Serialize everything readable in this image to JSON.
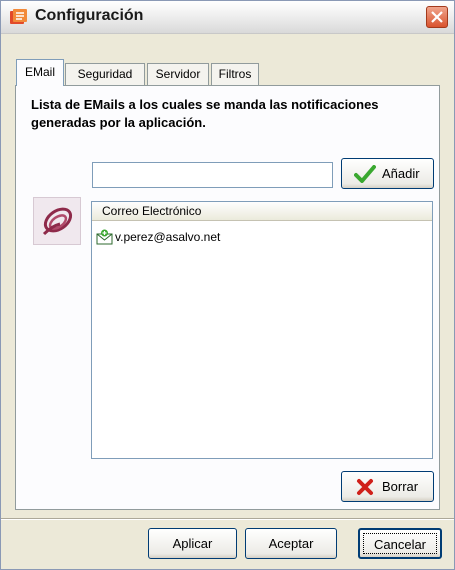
{
  "window": {
    "title": "Configuración"
  },
  "tabs": [
    {
      "label": "EMail",
      "active": true
    },
    {
      "label": "Seguridad",
      "active": false
    },
    {
      "label": "Servidor",
      "active": false
    },
    {
      "label": "Filtros",
      "active": false
    }
  ],
  "email_tab": {
    "description": "Lista de EMails a los cuales se manda las notificaciones generadas por la aplicación.",
    "email_input_value": "",
    "add_label": "Añadir",
    "list_header": "Correo Electrónico",
    "emails": [
      "v.perez@asalvo.net"
    ],
    "delete_label": "Borrar"
  },
  "footer": {
    "apply_label": "Aplicar",
    "accept_label": "Aceptar",
    "cancel_label": "Cancelar"
  },
  "icons": {
    "title": "settings-app-icon",
    "close": "close-icon",
    "add": "checkmark-icon",
    "delete": "x-icon",
    "logo": "app-logo-icon",
    "email_item": "email-icon"
  },
  "colors": {
    "window_bg": "#ece9d8",
    "close_button": "#d9532e",
    "add_check": "#3aa82f",
    "delete_x": "#d0201a"
  }
}
